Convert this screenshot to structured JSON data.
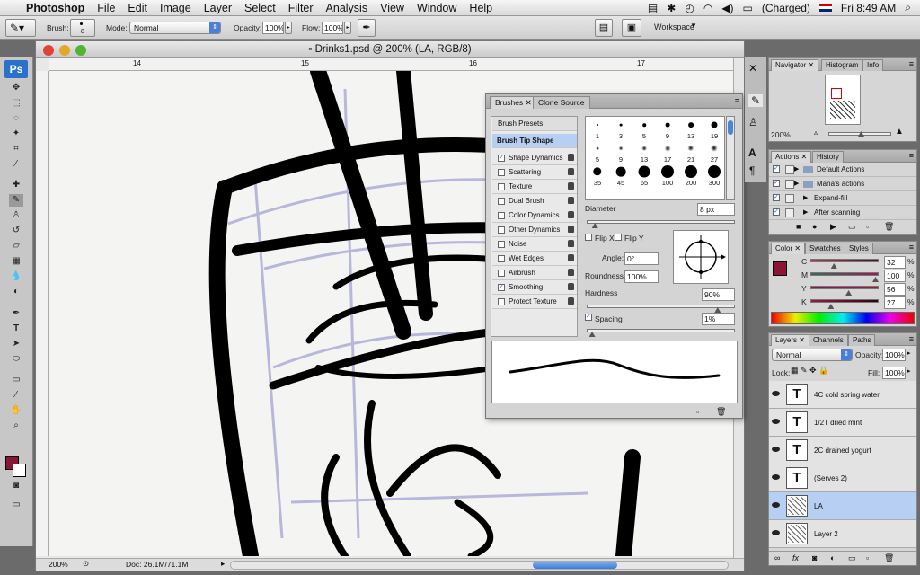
{
  "menubar": {
    "app_name": "Photoshop",
    "items": [
      "File",
      "Edit",
      "Image",
      "Layer",
      "Select",
      "Filter",
      "Analysis",
      "View",
      "Window",
      "Help"
    ],
    "battery": "(Charged)",
    "clock": "Fri 8:49 AM"
  },
  "options": {
    "brush_label": "Brush:",
    "brush_size": "8",
    "mode_label": "Mode:",
    "mode_value": "Normal",
    "opacity_label": "Opacity:",
    "opacity_value": "100%",
    "flow_label": "Flow:",
    "flow_value": "100%",
    "workspace_label": "Workspace"
  },
  "document": {
    "title": "Drinks1.psd @ 200% (LA, RGB/8)",
    "ruler_ticks": [
      "14",
      "15",
      "16",
      "17",
      "18"
    ],
    "zoom": "200%",
    "doc_info": "Doc: 26.1M/71.1M"
  },
  "brushes_panel": {
    "tabs": [
      "Brushes",
      "Clone Source"
    ],
    "presets_label": "Brush Presets",
    "tip_shape_label": "Brush Tip Shape",
    "options": [
      {
        "label": "Shape Dynamics",
        "checked": true
      },
      {
        "label": "Scattering",
        "checked": false
      },
      {
        "label": "Texture",
        "checked": false
      },
      {
        "label": "Dual Brush",
        "checked": false
      },
      {
        "label": "Color Dynamics",
        "checked": false
      },
      {
        "label": "Other Dynamics",
        "checked": false
      },
      {
        "label": "Noise",
        "checked": false
      },
      {
        "label": "Wet Edges",
        "checked": false
      },
      {
        "label": "Airbrush",
        "checked": false
      },
      {
        "label": "Smoothing",
        "checked": true
      },
      {
        "label": "Protect Texture",
        "checked": false
      }
    ],
    "tip_sizes": [
      "1",
      "3",
      "5",
      "9",
      "13",
      "19",
      "5",
      "9",
      "13",
      "17",
      "21",
      "27",
      "35",
      "45",
      "65",
      "100",
      "200",
      "300"
    ],
    "diameter_label": "Diameter",
    "diameter_value": "8 px",
    "diameter_level": 0.03,
    "flip_x": "Flip X",
    "flip_y": "Flip Y",
    "angle_label": "Angle:",
    "angle_value": "0°",
    "roundness_label": "Roundness:",
    "roundness_value": "100%",
    "hardness_label": "Hardness",
    "hardness_value": "90%",
    "hardness_level": 0.9,
    "spacing_label": "Spacing",
    "spacing_value": "1%",
    "spacing_checked": true,
    "spacing_level": 0.01
  },
  "navigator_panel": {
    "tabs": [
      "Navigator",
      "Histogram",
      "Info"
    ],
    "zoom": "200%"
  },
  "actions_panel": {
    "tabs": [
      "Actions",
      "History"
    ],
    "rows": [
      {
        "label": "Default Actions",
        "indent": 1,
        "folder": true
      },
      {
        "label": "Mana's actions",
        "indent": 1,
        "folder": true
      },
      {
        "label": "Expand-fill",
        "indent": 2,
        "folder": false
      },
      {
        "label": "After scanning",
        "indent": 2,
        "folder": false
      }
    ]
  },
  "color_panel": {
    "tabs": [
      "Color",
      "Swatches",
      "Styles"
    ],
    "foreground": "#8a1535",
    "channels": [
      {
        "label": "C",
        "value": "32",
        "level": 0.32
      },
      {
        "label": "M",
        "value": "100",
        "level": 1.0
      },
      {
        "label": "Y",
        "value": "56",
        "level": 0.56
      },
      {
        "label": "K",
        "value": "27",
        "level": 0.27
      }
    ]
  },
  "layers_panel": {
    "tabs": [
      "Layers",
      "Channels",
      "Paths"
    ],
    "blend_mode": "Normal",
    "opacity_label": "Opacity:",
    "opacity_value": "100%",
    "lock_label": "Lock:",
    "fill_label": "Fill:",
    "fill_value": "100%",
    "layers": [
      {
        "name": "4C cold spring water",
        "type": "text",
        "selected": false
      },
      {
        "name": "1/2T dried mint",
        "type": "text",
        "selected": false
      },
      {
        "name": "2C drained yogurt",
        "type": "text",
        "selected": false
      },
      {
        "name": "(Serves 2)",
        "type": "text",
        "selected": false
      },
      {
        "name": "LA",
        "type": "raster",
        "selected": true
      },
      {
        "name": "Layer 2",
        "type": "raster",
        "selected": false
      }
    ]
  },
  "tools_panel": {
    "badge": "Ps"
  },
  "icons": [
    "apple-icon",
    "brush-tool-icon",
    "wifi-icon",
    "battery-icon",
    "flag-icon",
    "search-icon",
    "eye-icon",
    "lock-icon",
    "text-layer-icon",
    "folder-icon"
  ]
}
